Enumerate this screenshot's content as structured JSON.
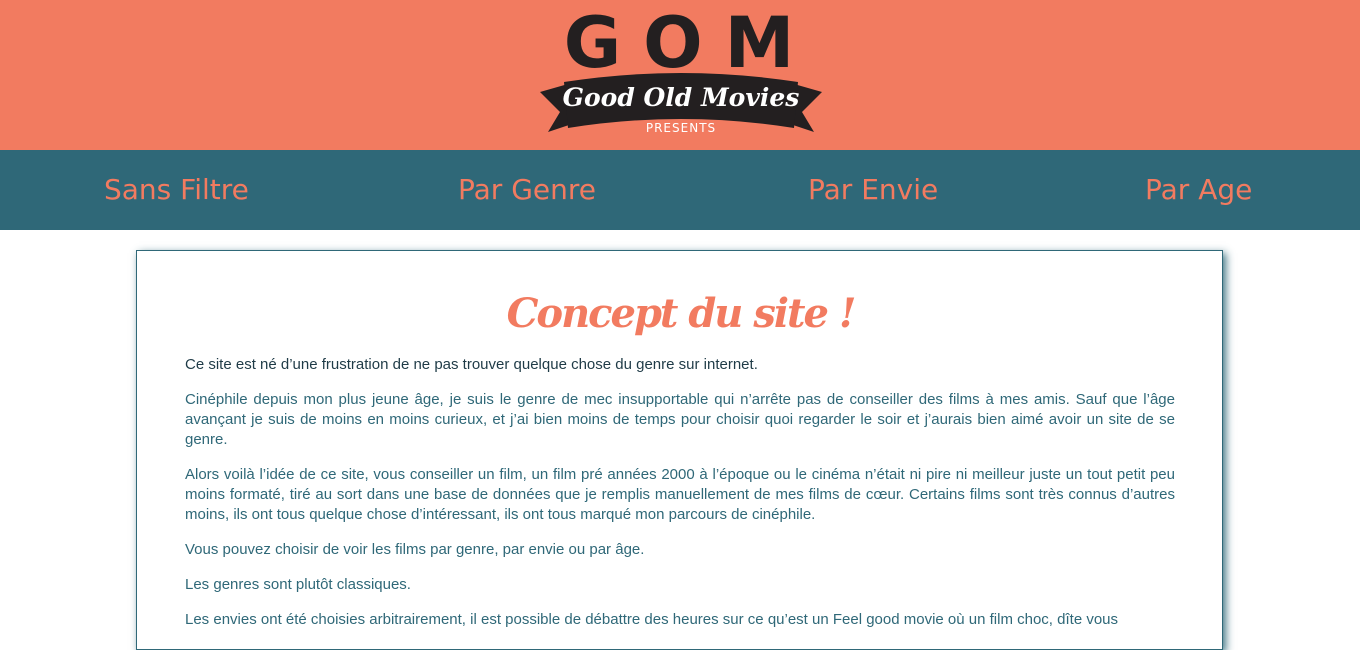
{
  "header": {
    "logo_title": "GOM",
    "logo_tagline": "Good Old Movies",
    "logo_presents": "PRESENTS",
    "background_color": "#f27b60",
    "text_color": "#231f20"
  },
  "nav": {
    "background_color": "#2f6878",
    "link_color": "#f27b60",
    "items": [
      {
        "label": "Sans Filtre"
      },
      {
        "label": "Par Genre"
      },
      {
        "label": "Par Envie"
      },
      {
        "label": "Par Age"
      }
    ]
  },
  "content": {
    "title": "Concept du site !",
    "intro": "Ce site est né d’une frustration de ne pas trouver quelque chose du genre sur internet.",
    "paragraphs": [
      "Cinéphile depuis mon plus jeune âge, je suis le genre de mec insupportable qui n’arrête pas de conseiller des films à mes amis. Sauf que l’âge avançant je suis de moins en moins curieux, et j’ai bien moins de temps pour choisir quoi regarder le soir et j’aurais bien aimé avoir un site de se genre.",
      "Alors voilà l’idée de ce site, vous conseiller un film, un film pré années 2000 à l’époque ou le cinéma n’était ni pire ni meilleur juste un tout petit peu moins formaté, tiré au sort dans une base de données que je remplis manuellement de mes films de cœur. Certains films sont très connus d’autres moins, ils ont tous quelque chose d’intéressant, ils ont tous marqué mon parcours de cinéphile.",
      "Vous pouvez choisir de voir les films par genre, par envie ou par âge.",
      "Les genres sont plutôt classiques.",
      "Les envies ont été choisies arbitrairement, il est possible de débattre des heures sur ce qu’est un Feel good movie où un film choc, dîte vous"
    ]
  }
}
